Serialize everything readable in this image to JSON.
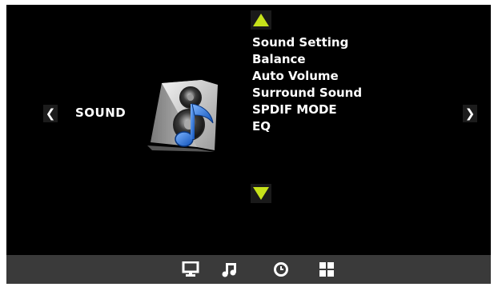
{
  "nav": {
    "category": "SOUND",
    "left_arrow": "❮",
    "right_arrow": "❯"
  },
  "menu": {
    "items": [
      "Sound Setting",
      "Balance",
      "Auto Volume",
      "Surround Sound",
      "SPDIF MODE",
      "EQ"
    ]
  },
  "icons": {
    "main": "speaker-music-icon",
    "scroll_up": "triangle-up-icon",
    "scroll_down": "triangle-down-icon",
    "bottom_bar": [
      "monitor-icon",
      "music-note-icon",
      "clock-icon",
      "grid-icon"
    ]
  },
  "colors": {
    "accent": "#c6e21a",
    "background": "#000000",
    "bottom_bar": "#3a3a3a",
    "text": "#ffffff"
  }
}
